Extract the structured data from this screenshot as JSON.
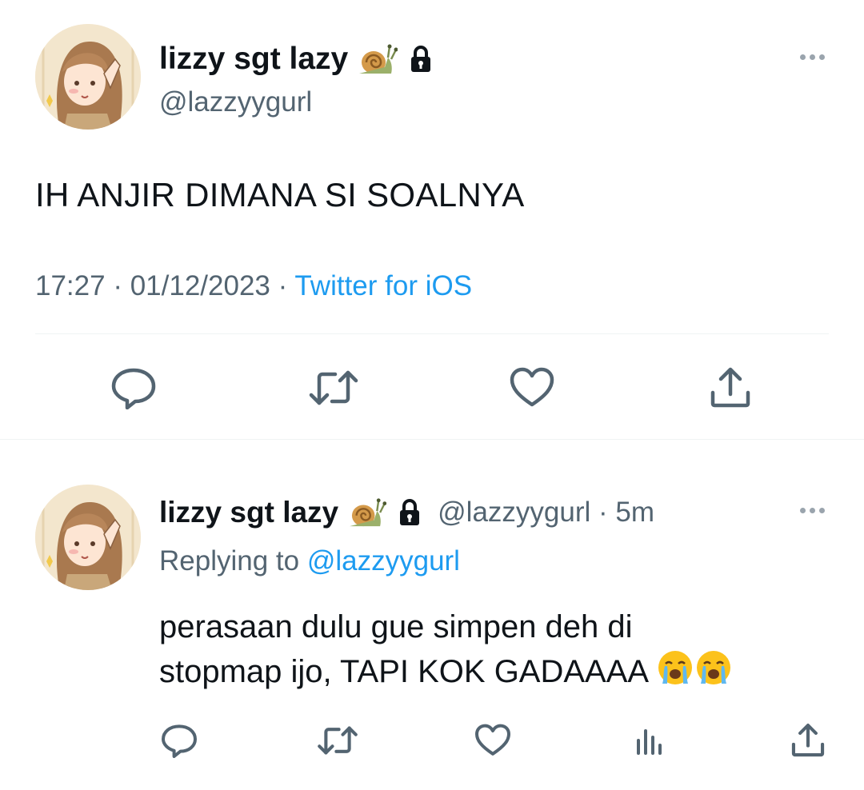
{
  "tweet": {
    "display_name": "lizzy sgt lazy",
    "handle": "@lazzyygurl",
    "text": "IH ANJIR DIMANA SI SOALNYA",
    "time": "17:27",
    "sep1": " · ",
    "date": "01/12/2023",
    "sep2": " · ",
    "source": "Twitter for iOS",
    "icons": {
      "snail": "snail-emoji",
      "lock": "lock-icon",
      "more": "more-icon",
      "reply": "reply-icon",
      "retweet": "retweet-icon",
      "like": "like-icon",
      "share": "share-icon"
    }
  },
  "reply": {
    "display_name": "lizzy sgt lazy",
    "handle": "@lazzyygurl",
    "sep": " · ",
    "age": "5m",
    "replying_to_label": "Replying to ",
    "replying_to_mention": "@lazzyygurl",
    "text_line1": "perasaan dulu gue simpen deh di",
    "text_line2": "stopmap ijo, TAPI KOK GADAAAA",
    "icons": {
      "reply": "reply-icon",
      "retweet": "retweet-icon",
      "like": "like-icon",
      "views": "views-icon",
      "share": "share-icon",
      "emoji": "crying-face-emoji"
    }
  },
  "colors": {
    "text": "#0f1419",
    "secondary": "#536471",
    "accent": "#1d9bf0",
    "divider": "#eff3f4"
  }
}
